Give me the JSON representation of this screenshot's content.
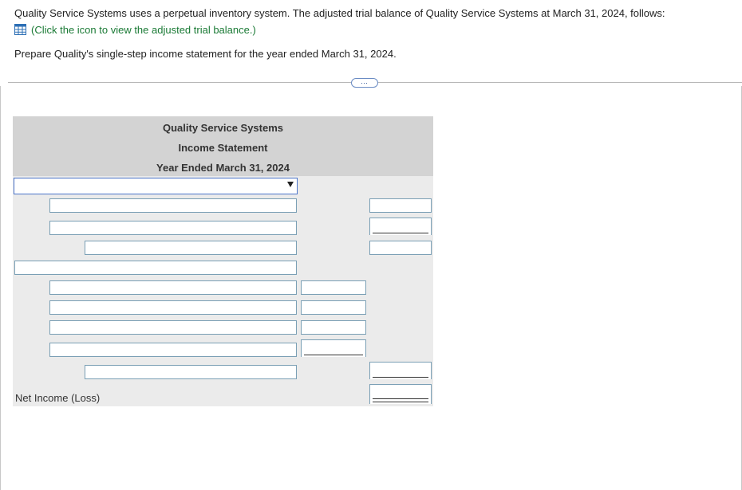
{
  "intro_text": "Quality Service Systems uses a perpetual inventory system. The adjusted trial balance of Quality Service Systems at March 31, 2024, follows:",
  "link_text": "(Click the icon to view the adjusted trial balance.)",
  "instruction": "Prepare Quality's single-step income statement for the year ended March 31, 2024.",
  "expand_button": "⋯",
  "statement": {
    "company": "Quality Service Systems",
    "title": "Income Statement",
    "period": "Year Ended March 31, 2024",
    "net_income_label": "Net Income (Loss)"
  },
  "icons": {
    "table_icon": "table-icon",
    "dropdown_arrow": "chevron-down-icon"
  },
  "colors": {
    "link": "#1a7a35",
    "header_bg": "#d3d3d3",
    "body_bg": "#ebebeb",
    "input_border": "#7a9fb5",
    "dropdown_border": "#4a73c9"
  }
}
